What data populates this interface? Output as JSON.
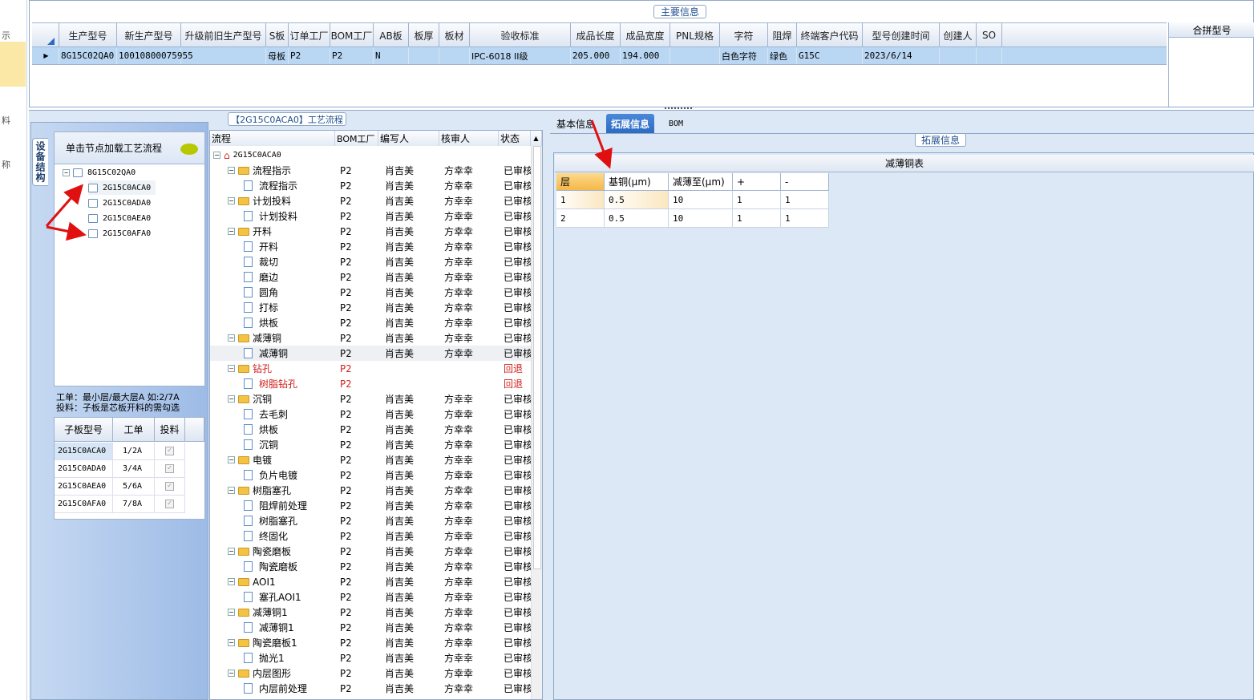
{
  "left_strip": {
    "labels": [
      "示",
      "料",
      "称"
    ]
  },
  "main_info": {
    "title": "主要信息",
    "columns": [
      "生产型号",
      "新生产型号",
      "升级前旧生产型号",
      "S板",
      "订单工厂",
      "BOM工厂",
      "AB板",
      "板厚",
      "板材",
      "验收标准",
      "成品长度",
      "成品宽度",
      "PNL规格",
      "字符",
      "阻焊",
      "终端客户代码",
      "型号创建时间",
      "创建人",
      "SO"
    ],
    "row": [
      "8G15C02QA0",
      "10010800075955",
      "",
      "母板",
      "P2",
      "P2",
      "N",
      "",
      "",
      "IPC-6018 II级",
      "205.000",
      "194.000",
      "",
      "白色字符",
      "绿色",
      "G15C",
      "2023/6/14",
      "",
      ""
    ],
    "merge_header": "合拼型号"
  },
  "side_tab": "设备结构",
  "tree": {
    "header": "单击节点加载工艺流程",
    "root": "8G15C02QA0",
    "children": [
      "2G15C0ACA0",
      "2G15C0ADA0",
      "2G15C0AEA0",
      "2G15C0AFA0"
    ]
  },
  "note": {
    "line1": "工单：最小层/最大层A 如:2/7A",
    "line2": "投料：子板是芯板开料的需勾选"
  },
  "sub_grid": {
    "headers": [
      "子板型号",
      "工单",
      "投料"
    ],
    "rows": [
      {
        "model": "2G15C0ACA0",
        "order": "1/2A",
        "check": "✓"
      },
      {
        "model": "2G15C0ADA0",
        "order": "3/4A",
        "check": "✓"
      },
      {
        "model": "2G15C0AEA0",
        "order": "5/6A",
        "check": "✓"
      },
      {
        "model": "2G15C0AFA0",
        "order": "7/8A",
        "check": "✓"
      }
    ]
  },
  "flow": {
    "title": "【2G15C0ACA0】工艺流程",
    "headers": [
      "流程",
      "BOM工厂",
      "编写人",
      "核审人",
      "状态"
    ],
    "root": "2G15C0ACA0",
    "rows": [
      {
        "name": "流程指示",
        "bom": "P2",
        "writer": "肖吉美",
        "reviewer": "方幸幸",
        "status": "已审核",
        "level": 1
      },
      {
        "name": "流程指示",
        "bom": "P2",
        "writer": "肖吉美",
        "reviewer": "方幸幸",
        "status": "已审核",
        "level": 2
      },
      {
        "name": "计划投料",
        "bom": "P2",
        "writer": "肖吉美",
        "reviewer": "方幸幸",
        "status": "已审核",
        "level": 1
      },
      {
        "name": "计划投料",
        "bom": "P2",
        "writer": "肖吉美",
        "reviewer": "方幸幸",
        "status": "已审核",
        "level": 2
      },
      {
        "name": "开料",
        "bom": "P2",
        "writer": "肖吉美",
        "reviewer": "方幸幸",
        "status": "已审核",
        "level": 1
      },
      {
        "name": "开料",
        "bom": "P2",
        "writer": "肖吉美",
        "reviewer": "方幸幸",
        "status": "已审核",
        "level": 2
      },
      {
        "name": "裁切",
        "bom": "P2",
        "writer": "肖吉美",
        "reviewer": "方幸幸",
        "status": "已审核",
        "level": 2
      },
      {
        "name": "磨边",
        "bom": "P2",
        "writer": "肖吉美",
        "reviewer": "方幸幸",
        "status": "已审核",
        "level": 2
      },
      {
        "name": "圆角",
        "bom": "P2",
        "writer": "肖吉美",
        "reviewer": "方幸幸",
        "status": "已审核",
        "level": 2
      },
      {
        "name": "打标",
        "bom": "P2",
        "writer": "肖吉美",
        "reviewer": "方幸幸",
        "status": "已审核",
        "level": 2
      },
      {
        "name": "烘板",
        "bom": "P2",
        "writer": "肖吉美",
        "reviewer": "方幸幸",
        "status": "已审核",
        "level": 2
      },
      {
        "name": "减薄铜",
        "bom": "P2",
        "writer": "肖吉美",
        "reviewer": "方幸幸",
        "status": "已审核",
        "level": 1
      },
      {
        "name": "减薄铜",
        "bom": "P2",
        "writer": "肖吉美",
        "reviewer": "方幸幸",
        "status": "已审核",
        "level": 2,
        "selected": true
      },
      {
        "name": "钻孔",
        "bom": "P2",
        "writer": "",
        "reviewer": "",
        "status": "回退",
        "level": 1,
        "red": true
      },
      {
        "name": "树脂钻孔",
        "bom": "P2",
        "writer": "",
        "reviewer": "",
        "status": "回退",
        "level": 2,
        "red": true
      },
      {
        "name": "沉铜",
        "bom": "P2",
        "writer": "肖吉美",
        "reviewer": "方幸幸",
        "status": "已审核",
        "level": 1
      },
      {
        "name": "去毛刺",
        "bom": "P2",
        "writer": "肖吉美",
        "reviewer": "方幸幸",
        "status": "已审核",
        "level": 2
      },
      {
        "name": "烘板",
        "bom": "P2",
        "writer": "肖吉美",
        "reviewer": "方幸幸",
        "status": "已审核",
        "level": 2
      },
      {
        "name": "沉铜",
        "bom": "P2",
        "writer": "肖吉美",
        "reviewer": "方幸幸",
        "status": "已审核",
        "level": 2
      },
      {
        "name": "电镀",
        "bom": "P2",
        "writer": "肖吉美",
        "reviewer": "方幸幸",
        "status": "已审核",
        "level": 1
      },
      {
        "name": "负片电镀",
        "bom": "P2",
        "writer": "肖吉美",
        "reviewer": "方幸幸",
        "status": "已审核",
        "level": 2
      },
      {
        "name": "树脂塞孔",
        "bom": "P2",
        "writer": "肖吉美",
        "reviewer": "方幸幸",
        "status": "已审核",
        "level": 1
      },
      {
        "name": "阻焊前处理",
        "bom": "P2",
        "writer": "肖吉美",
        "reviewer": "方幸幸",
        "status": "已审核",
        "level": 2
      },
      {
        "name": "树脂塞孔",
        "bom": "P2",
        "writer": "肖吉美",
        "reviewer": "方幸幸",
        "status": "已审核",
        "level": 2
      },
      {
        "name": "终固化",
        "bom": "P2",
        "writer": "肖吉美",
        "reviewer": "方幸幸",
        "status": "已审核",
        "level": 2
      },
      {
        "name": "陶瓷磨板",
        "bom": "P2",
        "writer": "肖吉美",
        "reviewer": "方幸幸",
        "status": "已审核",
        "level": 1
      },
      {
        "name": "陶瓷磨板",
        "bom": "P2",
        "writer": "肖吉美",
        "reviewer": "方幸幸",
        "status": "已审核",
        "level": 2
      },
      {
        "name": "AOI1",
        "bom": "P2",
        "writer": "肖吉美",
        "reviewer": "方幸幸",
        "status": "已审核",
        "level": 1
      },
      {
        "name": "塞孔AOI1",
        "bom": "P2",
        "writer": "肖吉美",
        "reviewer": "方幸幸",
        "status": "已审核",
        "level": 2
      },
      {
        "name": "减薄铜1",
        "bom": "P2",
        "writer": "肖吉美",
        "reviewer": "方幸幸",
        "status": "已审核",
        "level": 1
      },
      {
        "name": "减薄铜1",
        "bom": "P2",
        "writer": "肖吉美",
        "reviewer": "方幸幸",
        "status": "已审核",
        "level": 2
      },
      {
        "name": "陶瓷磨板1",
        "bom": "P2",
        "writer": "肖吉美",
        "reviewer": "方幸幸",
        "status": "已审核",
        "level": 1
      },
      {
        "name": "抛光1",
        "bom": "P2",
        "writer": "肖吉美",
        "reviewer": "方幸幸",
        "status": "已审核",
        "level": 2
      },
      {
        "name": "内层图形",
        "bom": "P2",
        "writer": "肖吉美",
        "reviewer": "方幸幸",
        "status": "已审核",
        "level": 1
      },
      {
        "name": "内层前处理",
        "bom": "P2",
        "writer": "肖吉美",
        "reviewer": "方幸幸",
        "status": "已审核",
        "level": 2
      }
    ]
  },
  "right": {
    "tabs": [
      "基本信息",
      "拓展信息",
      "BOM"
    ],
    "active_tab": 1,
    "section_title": "拓展信息",
    "table_title": "减薄铜表",
    "headers": [
      "层",
      "基铜(μm)",
      "减薄至(μm)",
      "+",
      "-"
    ],
    "rows": [
      [
        "1",
        "0.5",
        "10",
        "1",
        "1"
      ],
      [
        "2",
        "0.5",
        "10",
        "1",
        "1"
      ]
    ]
  },
  "colors": {
    "accent": "#2d6bc4",
    "selection": "#b9d7f3",
    "annotation_arrow": "#e01010",
    "error_text": "#d0201e"
  }
}
